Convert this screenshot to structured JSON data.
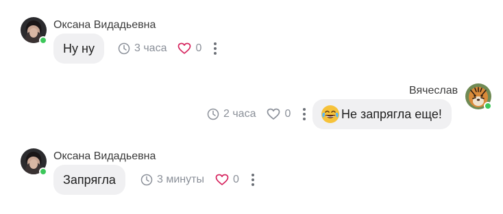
{
  "messages": [
    {
      "author": "Оксана Видадьевна",
      "text": "Ну ну",
      "time": "3 часа",
      "likes": "0",
      "liked_color": "#d6245e",
      "avatar_icon": "user-photo-woman",
      "online": true
    },
    {
      "author": "Вячеслав",
      "text": "Не запрягла еще!",
      "emoji": "face-with-tears-of-joy",
      "time": "2 часа",
      "likes": "0",
      "avatar_icon": "user-photo-tiger",
      "online": true
    },
    {
      "author": "Оксана Видадьевна",
      "text": "Запрягла",
      "time": "3 минуты",
      "likes": "0",
      "liked_color": "#d6245e",
      "avatar_icon": "user-photo-woman",
      "online": true
    }
  ],
  "colors": {
    "bubble_bg": "#f0f0f2",
    "meta_text": "#8a8f98",
    "online_dot": "#3cc75a",
    "heart_accent": "#d6245e"
  }
}
